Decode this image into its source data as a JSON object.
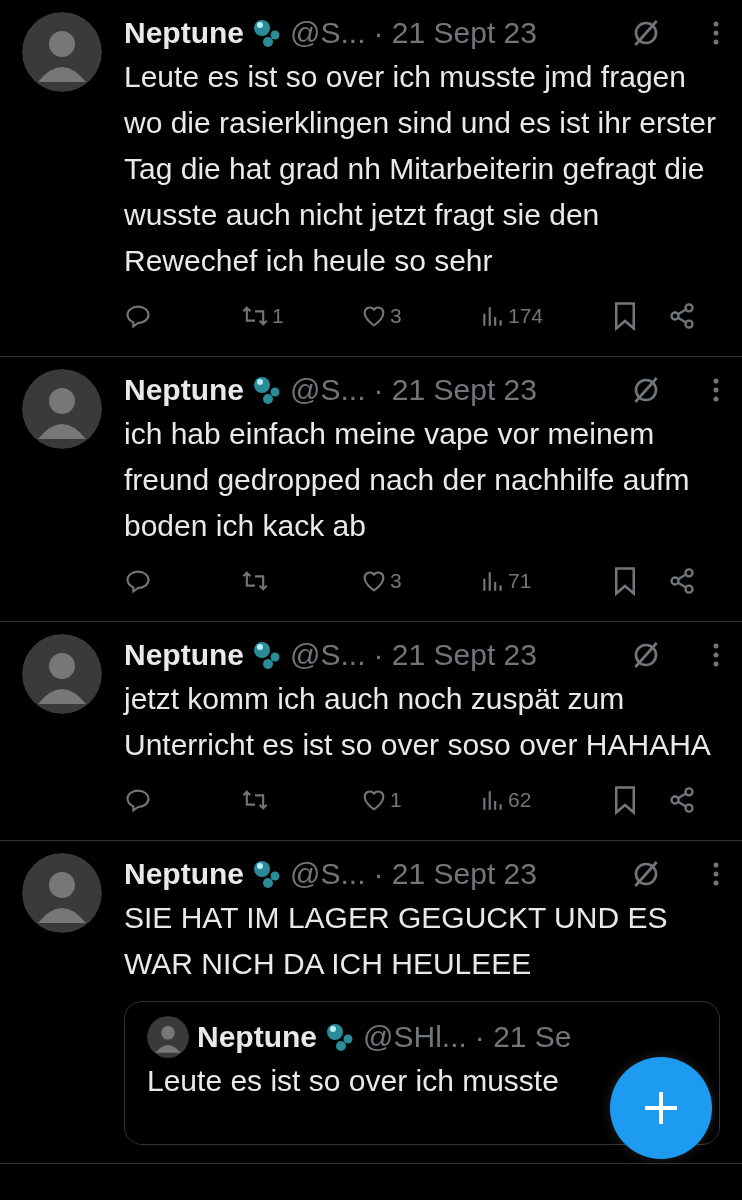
{
  "tweets": [
    {
      "name": "Neptune",
      "handle": "@S...",
      "date": "· 21 Sept 23",
      "text": "Leute es ist so over ich musste jmd fragen wo die rasierklingen sind und es ist ihr erster Tag die hat grad nh Mitarbeiterin gefragt die wusste auch nicht jetzt fragt sie den Rewechef ich heule so sehr",
      "actions": {
        "retweets": "1",
        "likes": "3",
        "views": "174"
      }
    },
    {
      "name": "Neptune",
      "handle": "@S...",
      "date": "· 21 Sept 23",
      "text": "ich hab einfach meine vape vor meinem freund gedropped nach der nachhilfe aufm boden ich kack ab",
      "actions": {
        "likes": "3",
        "views": "71"
      }
    },
    {
      "name": "Neptune",
      "handle": "@S...",
      "date": "· 21 Sept 23",
      "text": "jetzt komm ich auch noch zuspät zum Unterricht es ist so over soso over HAHAHA",
      "actions": {
        "likes": "1",
        "views": "62"
      }
    },
    {
      "name": "Neptune",
      "handle": "@S...",
      "date": "· 21 Sept 23",
      "text": "SIE HAT IM LAGER GEGUCKT UND ES WAR NICH DA ICH HEULEEE",
      "quote": {
        "name": "Neptune",
        "handle": "@SHl...",
        "date": "· 21 Se",
        "text": "Leute es ist so over ich musste"
      }
    }
  ]
}
